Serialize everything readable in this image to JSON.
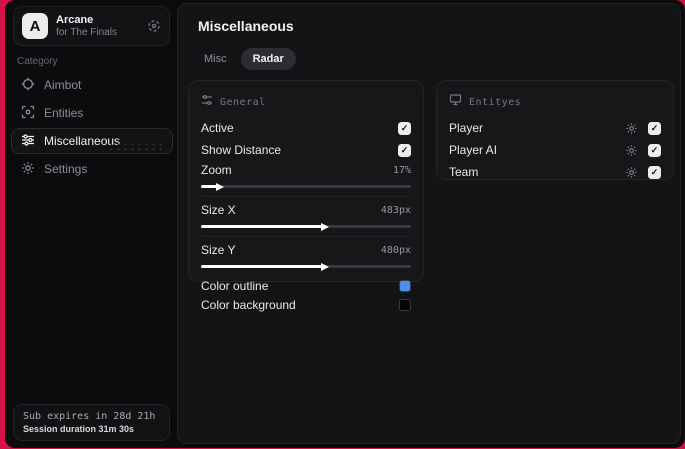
{
  "app": {
    "logo_letter": "A",
    "name": "Arcane",
    "subtitle": "for The Finals"
  },
  "sidebar": {
    "category_label": "Category",
    "items": [
      {
        "label": "Aimbot",
        "icon": "crosshair-icon",
        "active": false
      },
      {
        "label": "Entities",
        "icon": "scan-icon",
        "active": false
      },
      {
        "label": "Miscellaneous",
        "icon": "sliders-icon",
        "active": true
      },
      {
        "label": "Settings",
        "icon": "gear-icon",
        "active": false
      }
    ],
    "subscription": {
      "expires_text": "Sub expires in 28d 21h",
      "session_text": "Session duration 31m 30s"
    }
  },
  "main": {
    "title": "Miscellaneous",
    "tabs": [
      {
        "label": "Misc",
        "active": false
      },
      {
        "label": "Radar",
        "active": true
      }
    ],
    "general": {
      "title": "General",
      "toggles": [
        {
          "label": "Active",
          "checked": true
        },
        {
          "label": "Show Distance",
          "checked": true
        }
      ],
      "sliders": [
        {
          "label": "Zoom",
          "value": "17%",
          "fill": 8
        },
        {
          "label": "Size X",
          "value": "483px",
          "fill": 58
        },
        {
          "label": "Size Y",
          "value": "480px",
          "fill": 58
        }
      ],
      "colors": [
        {
          "label": "Color outline",
          "color": "#4e8fe3"
        },
        {
          "label": "Color background",
          "color": "#060606"
        }
      ]
    },
    "entities": {
      "title": "Entityes",
      "items": [
        {
          "label": "Player",
          "checked": true
        },
        {
          "label": "Player AI",
          "checked": true
        },
        {
          "label": "Team",
          "checked": true
        }
      ]
    }
  },
  "colors": {
    "backdrop_red": "#d31345",
    "swatch_blue": "#4e8fe3",
    "checkbox": "#ededef"
  }
}
